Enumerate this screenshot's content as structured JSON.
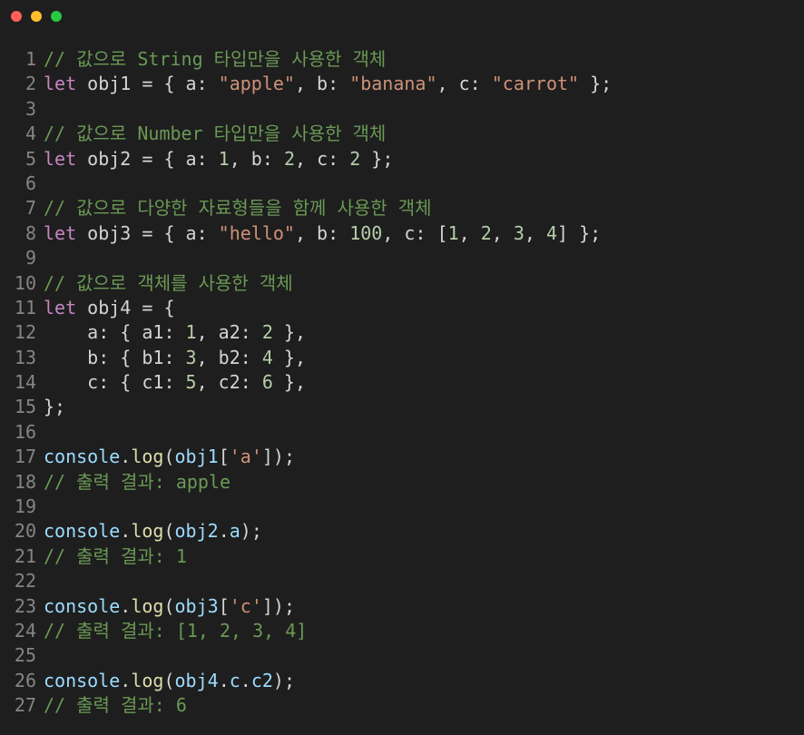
{
  "window": {
    "controls": {
      "close": "#ff5f57",
      "minimize": "#febc2e",
      "maximize": "#28c840"
    }
  },
  "editor": {
    "lines": [
      {
        "n": "1",
        "tokens": [
          {
            "t": "// 값으로 String 타입만을 사용한 객체",
            "c": "comment"
          }
        ]
      },
      {
        "n": "2",
        "tokens": [
          {
            "t": "let",
            "c": "kw"
          },
          {
            "t": " obj1 = { a: ",
            "c": "punc"
          },
          {
            "t": "\"apple\"",
            "c": "str"
          },
          {
            "t": ", b: ",
            "c": "punc"
          },
          {
            "t": "\"banana\"",
            "c": "str"
          },
          {
            "t": ", c: ",
            "c": "punc"
          },
          {
            "t": "\"carrot\"",
            "c": "str"
          },
          {
            "t": " };",
            "c": "punc"
          }
        ]
      },
      {
        "n": "3",
        "tokens": []
      },
      {
        "n": "4",
        "tokens": [
          {
            "t": "// 값으로 Number 타입만을 사용한 객체",
            "c": "comment"
          }
        ]
      },
      {
        "n": "5",
        "tokens": [
          {
            "t": "let",
            "c": "kw"
          },
          {
            "t": " obj2 = { a: ",
            "c": "punc"
          },
          {
            "t": "1",
            "c": "num"
          },
          {
            "t": ", b: ",
            "c": "punc"
          },
          {
            "t": "2",
            "c": "num"
          },
          {
            "t": ", c: ",
            "c": "punc"
          },
          {
            "t": "2",
            "c": "num"
          },
          {
            "t": " };",
            "c": "punc"
          }
        ]
      },
      {
        "n": "6",
        "tokens": []
      },
      {
        "n": "7",
        "tokens": [
          {
            "t": "// 값으로 다양한 자료형들을 함께 사용한 객체",
            "c": "comment"
          }
        ]
      },
      {
        "n": "8",
        "tokens": [
          {
            "t": "let",
            "c": "kw"
          },
          {
            "t": " obj3 = { a: ",
            "c": "punc"
          },
          {
            "t": "\"hello\"",
            "c": "str"
          },
          {
            "t": ", b: ",
            "c": "punc"
          },
          {
            "t": "100",
            "c": "num"
          },
          {
            "t": ", c: [",
            "c": "punc"
          },
          {
            "t": "1",
            "c": "num"
          },
          {
            "t": ", ",
            "c": "punc"
          },
          {
            "t": "2",
            "c": "num"
          },
          {
            "t": ", ",
            "c": "punc"
          },
          {
            "t": "3",
            "c": "num"
          },
          {
            "t": ", ",
            "c": "punc"
          },
          {
            "t": "4",
            "c": "num"
          },
          {
            "t": "] };",
            "c": "punc"
          }
        ]
      },
      {
        "n": "9",
        "tokens": []
      },
      {
        "n": "10",
        "tokens": [
          {
            "t": "// 값으로 객체를 사용한 객체",
            "c": "comment"
          }
        ]
      },
      {
        "n": "11",
        "tokens": [
          {
            "t": "let",
            "c": "kw"
          },
          {
            "t": " obj4 = {",
            "c": "punc"
          }
        ]
      },
      {
        "n": "12",
        "tokens": [
          {
            "t": "    a: { a1: ",
            "c": "punc"
          },
          {
            "t": "1",
            "c": "num"
          },
          {
            "t": ", a2: ",
            "c": "punc"
          },
          {
            "t": "2",
            "c": "num"
          },
          {
            "t": " },",
            "c": "punc"
          }
        ]
      },
      {
        "n": "13",
        "tokens": [
          {
            "t": "    b: { b1: ",
            "c": "punc"
          },
          {
            "t": "3",
            "c": "num"
          },
          {
            "t": ", b2: ",
            "c": "punc"
          },
          {
            "t": "4",
            "c": "num"
          },
          {
            "t": " },",
            "c": "punc"
          }
        ]
      },
      {
        "n": "14",
        "tokens": [
          {
            "t": "    c: { c1: ",
            "c": "punc"
          },
          {
            "t": "5",
            "c": "num"
          },
          {
            "t": ", c2: ",
            "c": "punc"
          },
          {
            "t": "6",
            "c": "num"
          },
          {
            "t": " },",
            "c": "punc"
          }
        ]
      },
      {
        "n": "15",
        "tokens": [
          {
            "t": "};",
            "c": "punc"
          }
        ]
      },
      {
        "n": "16",
        "tokens": []
      },
      {
        "n": "17",
        "tokens": [
          {
            "t": "console",
            "c": "var"
          },
          {
            "t": ".",
            "c": "punc"
          },
          {
            "t": "log",
            "c": "fn"
          },
          {
            "t": "(",
            "c": "punc"
          },
          {
            "t": "obj1",
            "c": "var"
          },
          {
            "t": "[",
            "c": "punc"
          },
          {
            "t": "'a'",
            "c": "str"
          },
          {
            "t": "]);",
            "c": "punc"
          }
        ]
      },
      {
        "n": "18",
        "tokens": [
          {
            "t": "// 출력 결과: apple",
            "c": "comment"
          }
        ]
      },
      {
        "n": "19",
        "tokens": []
      },
      {
        "n": "20",
        "tokens": [
          {
            "t": "console",
            "c": "var"
          },
          {
            "t": ".",
            "c": "punc"
          },
          {
            "t": "log",
            "c": "fn"
          },
          {
            "t": "(",
            "c": "punc"
          },
          {
            "t": "obj2",
            "c": "var"
          },
          {
            "t": ".",
            "c": "punc"
          },
          {
            "t": "a",
            "c": "var"
          },
          {
            "t": ");",
            "c": "punc"
          }
        ]
      },
      {
        "n": "21",
        "tokens": [
          {
            "t": "// 출력 결과: 1",
            "c": "comment"
          }
        ]
      },
      {
        "n": "22",
        "tokens": []
      },
      {
        "n": "23",
        "tokens": [
          {
            "t": "console",
            "c": "var"
          },
          {
            "t": ".",
            "c": "punc"
          },
          {
            "t": "log",
            "c": "fn"
          },
          {
            "t": "(",
            "c": "punc"
          },
          {
            "t": "obj3",
            "c": "var"
          },
          {
            "t": "[",
            "c": "punc"
          },
          {
            "t": "'c'",
            "c": "str"
          },
          {
            "t": "]);",
            "c": "punc"
          }
        ]
      },
      {
        "n": "24",
        "tokens": [
          {
            "t": "// 출력 결과: [1, 2, 3, 4]",
            "c": "comment"
          }
        ]
      },
      {
        "n": "25",
        "tokens": []
      },
      {
        "n": "26",
        "tokens": [
          {
            "t": "console",
            "c": "var"
          },
          {
            "t": ".",
            "c": "punc"
          },
          {
            "t": "log",
            "c": "fn"
          },
          {
            "t": "(",
            "c": "punc"
          },
          {
            "t": "obj4",
            "c": "var"
          },
          {
            "t": ".",
            "c": "punc"
          },
          {
            "t": "c",
            "c": "var"
          },
          {
            "t": ".",
            "c": "punc"
          },
          {
            "t": "c2",
            "c": "var"
          },
          {
            "t": ");",
            "c": "punc"
          }
        ]
      },
      {
        "n": "27",
        "tokens": [
          {
            "t": "// 출력 결과: 6",
            "c": "comment"
          }
        ]
      }
    ]
  }
}
